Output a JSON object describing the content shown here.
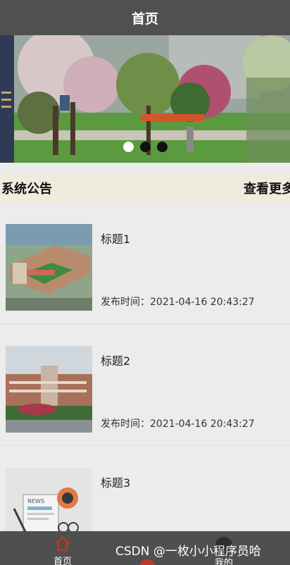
{
  "nav": {
    "title": "首页"
  },
  "banner": {
    "image": "campus-garden-photo",
    "dots": 3,
    "active_dot": 0
  },
  "notice": {
    "title": "系统公告",
    "more_label": "查看更多"
  },
  "items": [
    {
      "title": "标题1",
      "date": "发布时间：2021-04-16 20:43:27",
      "thumb": "school-aerial-image"
    },
    {
      "title": "标题2",
      "date": "发布时间：2021-04-16 20:43:27",
      "thumb": "school-building-image"
    },
    {
      "title": "标题3",
      "date": "",
      "thumb": "news-illustration-image"
    }
  ],
  "tabbar": {
    "home_label": "首页",
    "mine_label": "我的",
    "home_icon": "home-icon",
    "accent": "#c0392b"
  },
  "watermark": "CSDN @一枚小小程序员哈"
}
